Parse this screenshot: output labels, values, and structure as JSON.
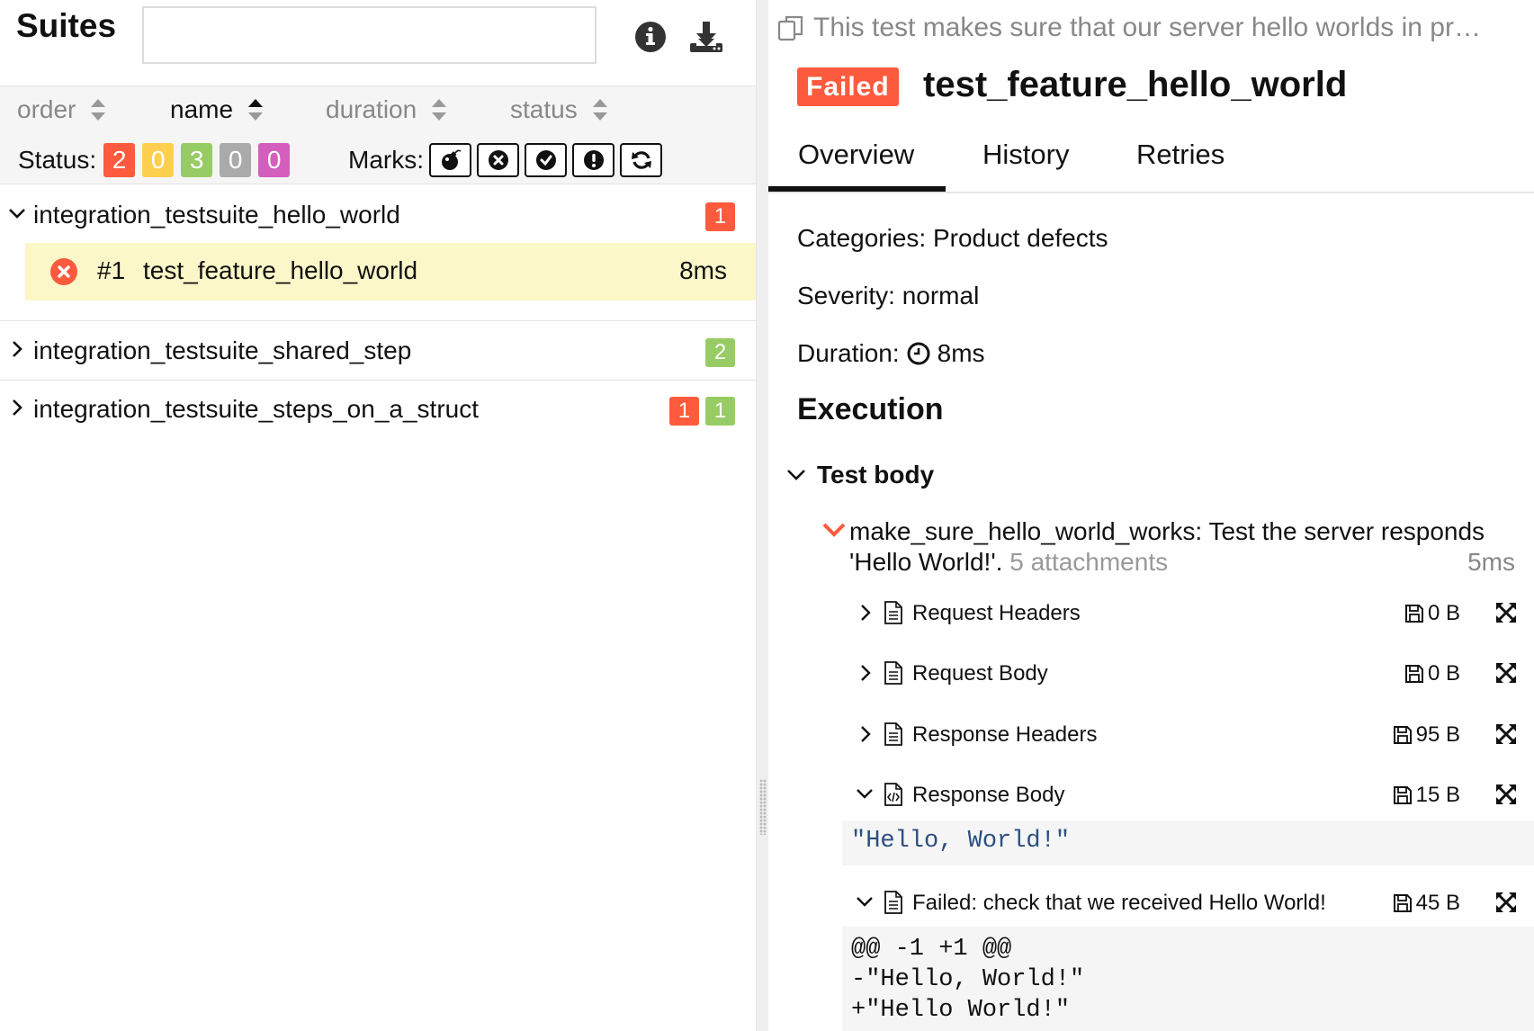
{
  "left": {
    "title": "Suites",
    "search": {
      "value": "",
      "placeholder": ""
    },
    "icons": [
      "info-icon",
      "download-icon"
    ],
    "sort": [
      {
        "label": "order",
        "active": false
      },
      {
        "label": "name",
        "active": true
      },
      {
        "label": "duration",
        "active": false
      },
      {
        "label": "status",
        "active": false
      }
    ],
    "status_label": "Status:",
    "status_counts": [
      {
        "status": "failed",
        "value": "2",
        "color": "#fd5a3e"
      },
      {
        "status": "broken",
        "value": "0",
        "color": "#ffd050"
      },
      {
        "status": "passed",
        "value": "3",
        "color": "#97cc64"
      },
      {
        "status": "skipped",
        "value": "0",
        "color": "#aaaaaa"
      },
      {
        "status": "unknown",
        "value": "0",
        "color": "#d35ebe"
      }
    ],
    "marks_label": "Marks:",
    "marks": [
      "flaky-icon",
      "new-failed-icon",
      "new-passed-icon",
      "new-broken-icon",
      "retries-icon"
    ],
    "groups": [
      {
        "name": "integration_testsuite_hello_world",
        "expanded": true,
        "badges": [
          {
            "value": "1",
            "color": "#fd5a3e"
          }
        ]
      },
      {
        "name": "integration_testsuite_shared_step",
        "expanded": false,
        "badges": [
          {
            "value": "2",
            "color": "#97cc64"
          }
        ]
      },
      {
        "name": "integration_testsuite_steps_on_a_struct",
        "expanded": false,
        "badges": [
          {
            "value": "1",
            "color": "#fd5a3e"
          },
          {
            "value": "1",
            "color": "#97cc64"
          }
        ]
      }
    ],
    "selected_test": {
      "order": "#1",
      "name": "test_feature_hello_world",
      "duration": "8ms",
      "status": "failed"
    }
  },
  "right": {
    "description": "This test makes sure that our server hello worlds in pr…",
    "status_label": "Failed",
    "status_color": "#fd5a3e",
    "test_name": "test_feature_hello_world",
    "tabs": [
      {
        "label": "Overview",
        "active": true
      },
      {
        "label": "History",
        "active": false
      },
      {
        "label": "Retries",
        "active": false
      }
    ],
    "categories": "Categories: Product defects",
    "severity": "Severity: normal",
    "duration_label": "Duration:",
    "duration_value": "8ms",
    "execution_title": "Execution",
    "stage_title": "Test body",
    "step": {
      "title": "make_sure_hello_world_works: Test the server responds 'Hello World!'.",
      "attachments_label": "5 attachments",
      "duration": "5ms"
    },
    "attachments": [
      {
        "name": "Request Headers",
        "size": "0 B",
        "expanded": false,
        "file_icon": "document-icon"
      },
      {
        "name": "Request Body",
        "size": "0 B",
        "expanded": false,
        "file_icon": "document-icon"
      },
      {
        "name": "Response Headers",
        "size": "95 B",
        "expanded": false,
        "file_icon": "document-icon"
      },
      {
        "name": "Response Body",
        "size": "15 B",
        "expanded": true,
        "file_icon": "code-file-icon",
        "content": "\"Hello, World!\""
      },
      {
        "name": "Failed: check that we received Hello World!",
        "size": "45 B",
        "expanded": true,
        "file_icon": "document-icon",
        "content": "@@ -1 +1 @@\n-\"Hello, World!\"\n+\"Hello World!\""
      }
    ]
  }
}
